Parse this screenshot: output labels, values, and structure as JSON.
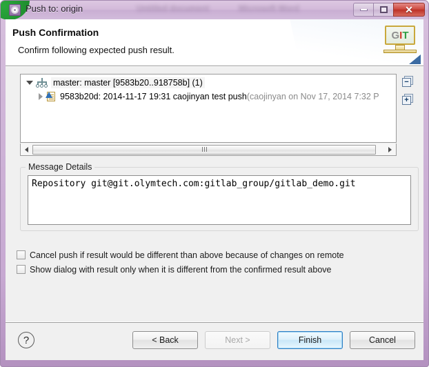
{
  "window": {
    "title": "Push to: origin",
    "icon": "push-gear-icon",
    "controls": {
      "minimize": "–",
      "maximize": "□",
      "close": "✕"
    },
    "ghost_text_1": "Untitled document",
    "ghost_text_2": "Microsoft Word"
  },
  "header": {
    "title": "Push Confirmation",
    "subtitle": "Confirm following expected push result.",
    "logo": {
      "g": "G",
      "i": "I",
      "t": "T"
    }
  },
  "tree": {
    "rows": [
      {
        "indent": 0,
        "expanded": true,
        "icon": "branch-icon",
        "label": "master: master [9583b20..918758b] (1)",
        "muted": ""
      },
      {
        "indent": 1,
        "expanded": false,
        "icon": "commit-icon",
        "label": "9583b20d: 2014-11-17 19:31 caojinyan test push ",
        "muted": "(caojinyan on Nov 17, 2014 7:32 P"
      }
    ],
    "collapse_all_label": "−",
    "expand_all_label": "+",
    "scroll_left": "◄",
    "scroll_right": "►"
  },
  "message_details": {
    "legend": "Message Details",
    "text": "Repository git@git.olymtech.com:gitlab_group/gitlab_demo.git"
  },
  "options": [
    {
      "checked": false,
      "label": "Cancel push if result would be different than above because of changes on remote"
    },
    {
      "checked": false,
      "label": "Show dialog with result only when it is different from the confirmed result above"
    }
  ],
  "footer": {
    "help_label": "?",
    "buttons": [
      {
        "label": "< Back",
        "state": "enabled"
      },
      {
        "label": "Next >",
        "state": "disabled"
      },
      {
        "label": "Finish",
        "state": "default"
      },
      {
        "label": "Cancel",
        "state": "enabled"
      }
    ]
  },
  "colors": {
    "title_bar": "#cdb2d6",
    "close_button": "#cf4b42",
    "default_button_border": "#2f7fc4",
    "git_green": "#2f9e44",
    "git_red": "#cf3a2a"
  }
}
